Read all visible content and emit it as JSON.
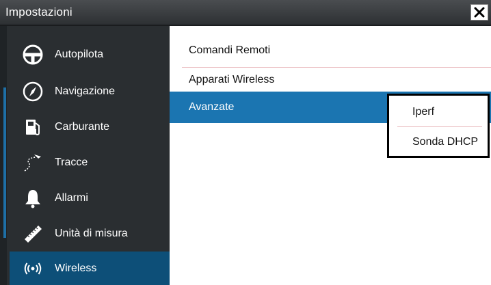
{
  "window": {
    "title": "Impostazioni"
  },
  "sidebar": {
    "items": [
      {
        "label": "Autopilota",
        "icon": "steering-wheel-icon"
      },
      {
        "label": "Navigazione",
        "icon": "compass-icon"
      },
      {
        "label": "Carburante",
        "icon": "fuel-pump-icon"
      },
      {
        "label": "Tracce",
        "icon": "track-icon"
      },
      {
        "label": "Allarmi",
        "icon": "bell-icon"
      },
      {
        "label": "Unità di misura",
        "icon": "ruler-icon"
      },
      {
        "label": "Wireless",
        "icon": "wireless-icon",
        "active": true
      }
    ]
  },
  "main": {
    "items": [
      {
        "label": "Comandi Remoti"
      },
      {
        "label": "Apparati Wireless"
      },
      {
        "label": "Avanzate",
        "selected": true
      }
    ]
  },
  "popup": {
    "items": [
      {
        "label": "Iperf"
      },
      {
        "label": "Sonda DHCP"
      }
    ]
  },
  "colors": {
    "selected": "#1b75b1",
    "active_sidebar": "#0d4f78",
    "sidebar_bg": "#2a2e31"
  }
}
